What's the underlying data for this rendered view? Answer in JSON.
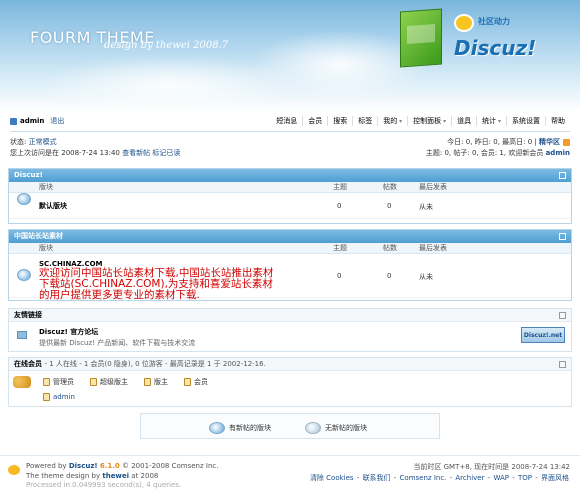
{
  "header": {
    "title": "FOURM THEME",
    "subtitle": "design by thewei 2008.7",
    "logo_cn": "社区动力",
    "logo_word": "Discuz!"
  },
  "menubar": {
    "username": "admin",
    "logout": "退出",
    "nav": [
      "短消息",
      "会员",
      "搜索",
      "标签",
      "我的",
      "控制面板",
      "道具",
      "统计",
      "系统设置",
      "帮助"
    ]
  },
  "status": {
    "status_label": "状态:",
    "status_value": "正常模式",
    "last_visit_prefix": "您上次访问是在",
    "last_visit_time": "2008-7-24 13:40",
    "view_new": "查看新帖",
    "mark_read": "标记已读",
    "today_prefix": "今日: 0, 昨日: 0, 最高日: 0",
    "boardmap": "精华区",
    "stats_prefix": "主题: 0, 帖子: 0, 会员: 1, 欢迎新会员",
    "newest_member": "admin"
  },
  "sections": [
    {
      "title": "Discuz!",
      "headers": {
        "forum": "版块",
        "threads": "主题",
        "posts": "帖数",
        "lastpost": "最后发表"
      },
      "forums": [
        {
          "name": "默认版块",
          "threads": "0",
          "posts": "0",
          "lastpost": "从未"
        }
      ]
    },
    {
      "title": "中国站长站素材",
      "headers": {
        "forum": "版块",
        "threads": "主题",
        "posts": "帖数",
        "lastpost": "最后发表"
      },
      "forums": [
        {
          "name": "SC.CHINAZ.COM",
          "threads": "0",
          "posts": "0",
          "lastpost": "从未"
        }
      ]
    }
  ],
  "watermark": {
    "line1": "欢迎访问中国站长站素材下载,中国站长站推出素材",
    "line2": "下载站(SC.CHINAZ.COM),为支持和喜爱站长素材",
    "line3": "的用户提供更多更专业的素材下载."
  },
  "friend_links": {
    "title": "友情链接",
    "name": "Discuz! 官方论坛",
    "desc": "提供最新 Discuz! 产品新闻、软件下载与技术交流",
    "badge": "Discuz!.net"
  },
  "online": {
    "title": "在线会员",
    "summary": "- 1 人在线 - 1 会员(0 隐身), 0 位游客 - 最高记录是 1 于 2002-12-16.",
    "roles": [
      "管理员",
      "超级版主",
      "版主",
      "会员"
    ],
    "user": "admin"
  },
  "legend": {
    "new_posts": "有新帖的版块",
    "no_new_posts": "无新帖的版块"
  },
  "footer": {
    "powered_prefix": "Powered by",
    "product": "Discuz!",
    "version": "6.1.0",
    "copyright": "© 2001-2008 Comsenz Inc.",
    "theme_prefix": "The theme design by",
    "designer": "thewei",
    "theme_year": "at 2008",
    "processed": "Processed in 0.049993 second(s), 4 queries.",
    "time_info": "当前时区 GMT+8, 现在时间是 2008-7-24 13:42",
    "links": [
      "清除 Cookies",
      "联系我们",
      "Comsenz Inc.",
      "Archiver",
      "WAP",
      "TOP"
    ],
    "style_switch": "界面风格"
  },
  "colors": {
    "accent": "#4f9ed3",
    "link": "#1a4f8a",
    "watermark": "#d00000"
  }
}
